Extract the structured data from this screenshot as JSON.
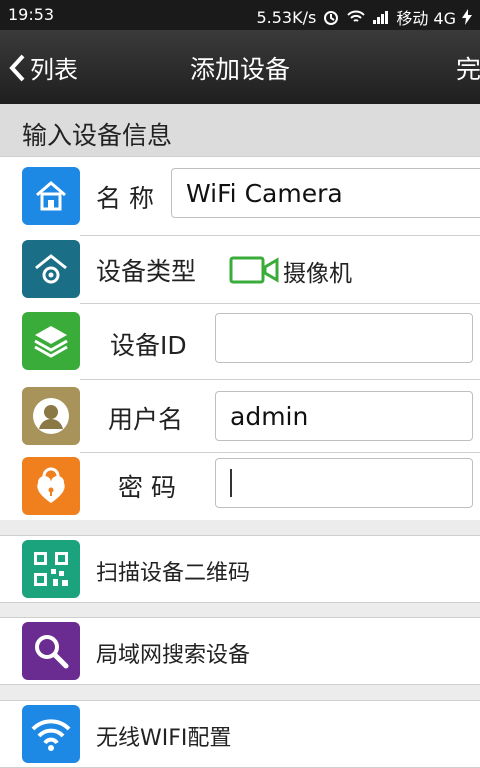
{
  "status": {
    "time": "19:53",
    "net_speed": "5.53K/s",
    "carrier": "移动 4G"
  },
  "titlebar": {
    "back_label": "列表",
    "title": "添加设备",
    "done_label": "完"
  },
  "section": {
    "title": "输入设备信息"
  },
  "form": {
    "name_label": "名 称",
    "name_value": "WiFi Camera",
    "type_label": "设备类型",
    "type_value": "摄像机",
    "id_label": "设备ID",
    "id_value": "",
    "user_label": "用户名",
    "user_value": "admin",
    "pwd_label": "密 码",
    "pwd_value": ""
  },
  "actions": [
    {
      "label": "扫描设备二维码"
    },
    {
      "label": "局域网搜索设备"
    },
    {
      "label": "无线WIFI配置"
    }
  ],
  "colors": {
    "name_icon": "#1e88e5",
    "type_icon": "#1a6e85",
    "id_icon": "#3aac3a",
    "user_icon": "#a8935a",
    "pwd_icon": "#f0801e",
    "qr_icon": "#1aa37c",
    "search_icon": "#6a2c91",
    "wifi_icon": "#1e88e5"
  }
}
